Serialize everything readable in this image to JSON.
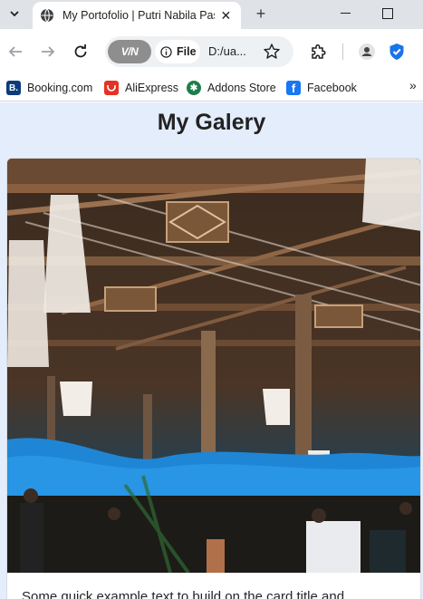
{
  "browser": {
    "tab": {
      "title": "My Portofolio | Putri Nabila Pas",
      "close_glyph": "✕"
    },
    "new_tab_glyph": "+",
    "omnibox": {
      "vpn_label": "V/N",
      "file_label": "File",
      "url": "D:/ua..."
    },
    "bookmarks": [
      {
        "label": "Booking.com",
        "icon": "booking-icon",
        "color": "#0c3b7c",
        "glyph": "B."
      },
      {
        "label": "AliExpress",
        "icon": "aliexpress-icon",
        "color": "#e43225",
        "glyph": ""
      },
      {
        "label": "Addons Store",
        "icon": "addons-store-icon",
        "color": "#1e7d4a",
        "glyph": "✱"
      },
      {
        "label": "Facebook",
        "icon": "facebook-icon",
        "color": "#1877f2",
        "glyph": "f"
      }
    ],
    "bookmarks_more_glyph": "»"
  },
  "page": {
    "heading": "My Galery",
    "card": {
      "image_alt": "Bamboo open-air restaurant interior with lanterns at night",
      "text": "Some quick example text to build on the card title and"
    }
  },
  "colors": {
    "page_background": "#e4edfb",
    "tab_strip": "#dfe3e7",
    "accent_shield": "#1a73e8"
  }
}
